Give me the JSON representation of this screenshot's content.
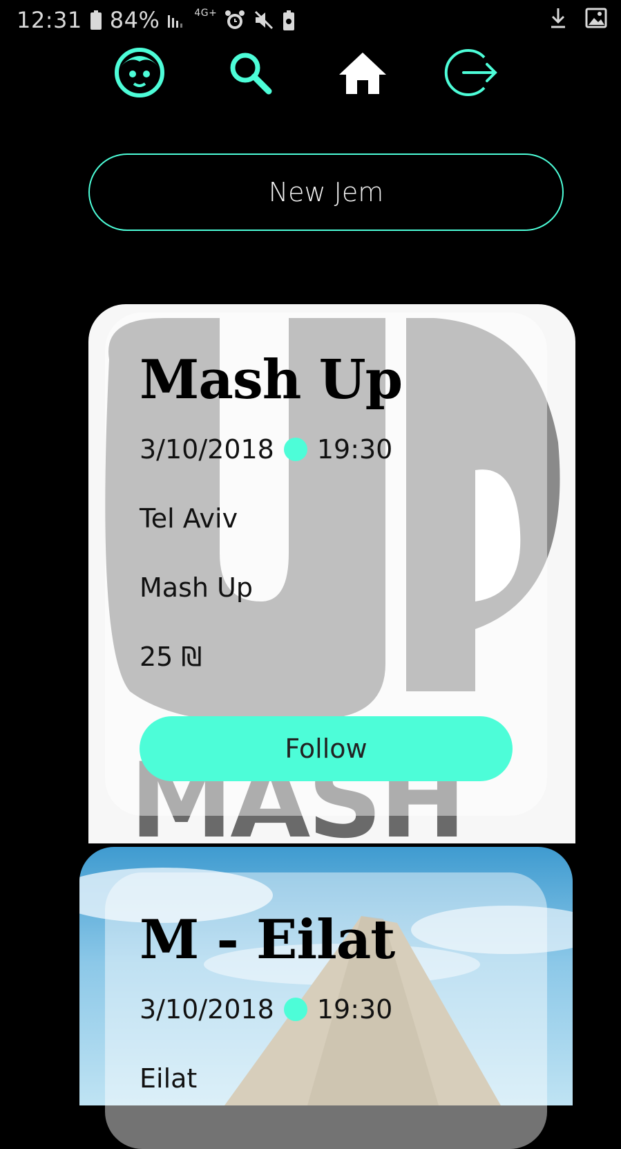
{
  "status_bar": {
    "time": "12:31",
    "battery": "84%",
    "network": "4G+"
  },
  "nav": {
    "items": [
      "profile",
      "search",
      "home",
      "logout"
    ],
    "accent": "#4dfdd8"
  },
  "new_jem_button": "New Jem",
  "events": [
    {
      "title": "Mash Up",
      "date": "3/10/2018",
      "time": "19:30",
      "location": "Tel Aviv",
      "name": "Mash Up",
      "price": "25 ₪",
      "follow_label": "Follow",
      "image_text": "MASH"
    },
    {
      "title": "M - Eilat",
      "date": "3/10/2018",
      "time": "19:30",
      "location": "Eilat"
    }
  ]
}
